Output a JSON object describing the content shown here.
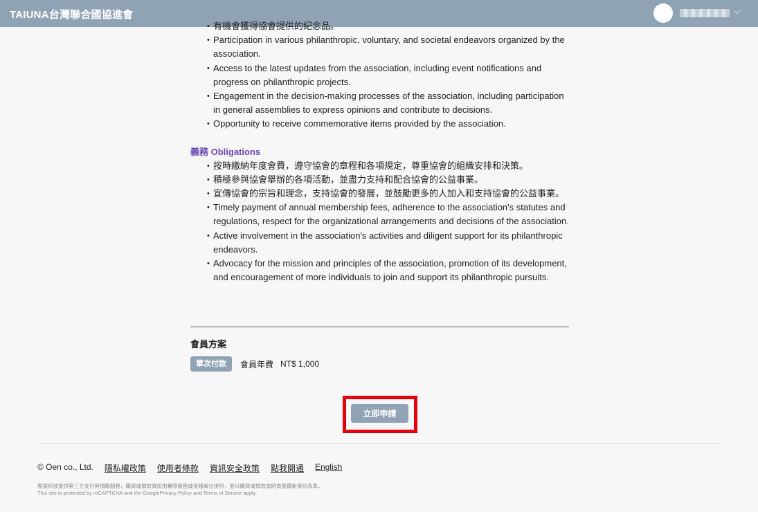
{
  "header": {
    "brand": "TAIUNA台灣聯合國協進會"
  },
  "rights": {
    "items": [
      "有機會獲得協會提供的紀念品。",
      "Participation in various philanthropic, voluntary, and societal endeavors organized by the association.",
      "Access to the latest updates from the association, including event notifications and progress on philanthropic projects.",
      "Engagement in the decision-making processes of the association, including participation in general assemblies to express opinions and contribute to decisions.",
      "Opportunity to receive commemorative items provided by the association."
    ]
  },
  "obligations": {
    "heading": "義務 Obligations",
    "items": [
      "按時繳納年度會費，遵守協會的章程和各項規定，尊重協會的組織安排和決策。",
      "積極參與協會舉辦的各項活動，並盡力支持和配合協會的公益事業。",
      "宣傳協會的宗旨和理念，支持協會的發展，並鼓勵更多的人加入和支持協會的公益事業。",
      "Timely payment of annual membership fees, adherence to the association's statutes and regulations, respect for the organizational arrangements and decisions of the association.",
      "Active involvement in the association's activities and diligent support for its philanthropic endeavors.",
      "Advocacy for the mission and principles of the association, promotion of its development, and encouragement of more individuals to join and support its philanthropic pursuits."
    ]
  },
  "plan": {
    "title": "會員方案",
    "tag": "單次付款",
    "name": "會員年費",
    "price": "NT$ 1,000"
  },
  "apply": {
    "label": "立即申請"
  },
  "footer": {
    "copyright": "© Oen co., Ltd.",
    "links": [
      "隱私權政策",
      "使用者條款",
      "資訊安全政策",
      "點我開通",
      "English"
    ],
    "fine1": "應援科技提供第三方支付與捐贈服務，購買或捐款資訊由實際販售或受贈單位提供，並以購買或捐款當時頁面最新資訊為準。",
    "fine2": "This site is protected by reCAPTCHA and the GooglePrivacy Policy and Terms of Service apply."
  },
  "colors": {
    "header_bg": "#8fa3b5",
    "accent_purple": "#6a49b8",
    "highlight_red": "#e6000d"
  }
}
